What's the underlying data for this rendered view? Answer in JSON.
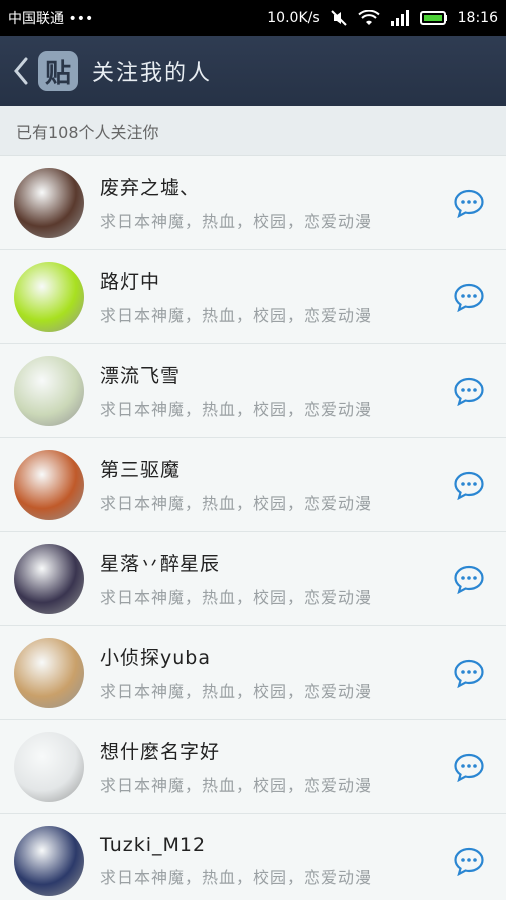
{
  "status_bar": {
    "carrier": "中国联通 •••",
    "speed": "10.0K/s",
    "time": "18:16"
  },
  "nav": {
    "logo_text": "贴",
    "title": "关注我的人"
  },
  "follower_count_text": "已有108个人关注你",
  "followers": [
    {
      "name": "废弃之墟、",
      "signature": "求日本神魔，热血，校园，恋爱动漫",
      "avatar_color": "#5a3a2e"
    },
    {
      "name": "路灯中",
      "signature": "求日本神魔，热血，校园，恋爱动漫",
      "avatar_color": "#a8e020"
    },
    {
      "name": "漂流飞雪",
      "signature": "求日本神魔，热血，校园，恋爱动漫",
      "avatar_color": "#cbd8b8"
    },
    {
      "name": "第三驱魔",
      "signature": "求日本神魔，热血，校园，恋爱动漫",
      "avatar_color": "#c05a2a"
    },
    {
      "name": "星落丷醉星辰",
      "signature": "求日本神魔，热血，校园，恋爱动漫",
      "avatar_color": "#3a3550"
    },
    {
      "name": "小侦探yuba",
      "signature": "求日本神魔，热血，校园，恋爱动漫",
      "avatar_color": "#c9a06a"
    },
    {
      "name": "想什麼名字好",
      "signature": "求日本神魔，热血，校园，恋爱动漫",
      "avatar_color": "#e3e6e7"
    },
    {
      "name": "Tuzki_M12",
      "signature": "求日本神魔，热血，校园，恋爱动漫",
      "avatar_color": "#2c3a6a"
    }
  ],
  "colors": {
    "accent": "#2a86d2",
    "nav_bg": "#2b374b"
  },
  "icons": {
    "back": "chevron-left-icon",
    "chat": "chat-bubble-icon"
  }
}
